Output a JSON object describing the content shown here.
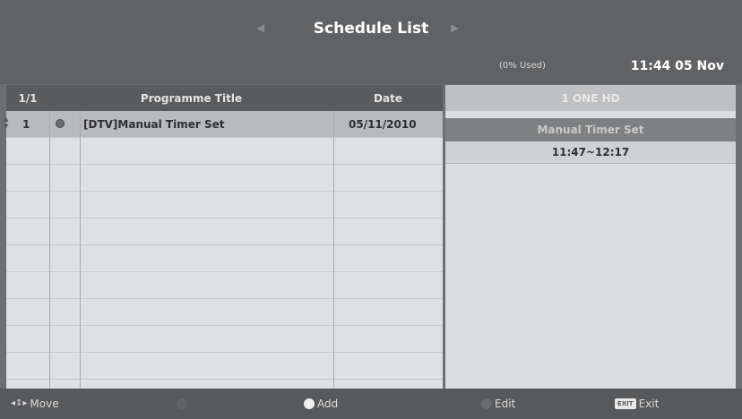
{
  "header": {
    "title": "Schedule List",
    "usage": "(0% Used)",
    "clock": "11:44 05 Nov"
  },
  "table": {
    "page": "1/1",
    "columns": [
      "Programme Title",
      "Date"
    ],
    "rows": [
      {
        "index": "1",
        "title": "[DTV]Manual Timer Set",
        "date": "05/11/2010"
      }
    ]
  },
  "details": {
    "channel": "1 ONE HD",
    "event": "Manual Timer Set",
    "time": "11:47~12:17"
  },
  "footer": {
    "move": "Move",
    "add": "Add",
    "edit": "Edit",
    "exit": "Exit",
    "exit_key": "EXIT"
  }
}
